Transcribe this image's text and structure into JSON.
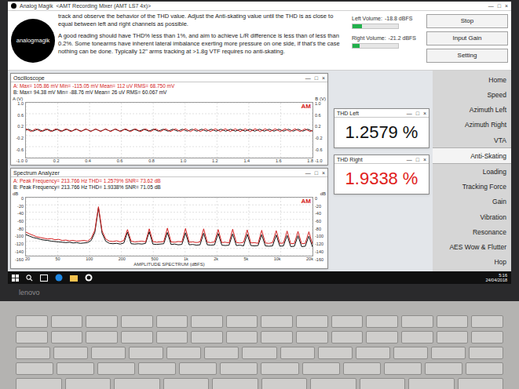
{
  "window": {
    "title": "Analog Magik",
    "subtitle": "<AMT Recording Mixer (AMT LS7 4x)>",
    "controls": [
      "—",
      "□",
      "×"
    ]
  },
  "logo": {
    "text": "analogmagik"
  },
  "instructions": [
    "track and observe the behavior of the THD value.  Adjust the Anti-skating value until the THD is as close to equal between left and right channels as possible.",
    "A good reading should have THD% less than 1%, and aim to achieve L/R difference is less than of less than 0.2%.   Some tonearms have inherent lateral imbalance exerting more pressure on one side, if that's the case nothing can be done.  Typically 12\" arms tracking at >1.8g VTF requires no anti-skating."
  ],
  "volumes": [
    {
      "label": "Left Volume:",
      "reading": "-18.8 dBFS",
      "level": 0.2,
      "color": "#22b14c"
    },
    {
      "label": "Right Volume:",
      "reading": "-21.2 dBFS",
      "level": 0.16,
      "color": "#22b14c"
    }
  ],
  "buttons": [
    "Stop",
    "Input Gain",
    "Setting"
  ],
  "oscilloscope": {
    "title": "Oscilloscope",
    "badge": "AM",
    "y_title_left": "A (V)",
    "y_title_right": "B (V)",
    "y_ticks": [
      "1.0",
      "0.6",
      "0.2",
      "-0.2",
      "-0.6",
      "-1.0"
    ],
    "right_ticks": [
      "1.0",
      "0.6",
      "0.2",
      "-0.2",
      "-0.6",
      "-1.0"
    ],
    "x_ticks": [
      "0",
      "0.2",
      "0.4",
      "0.6",
      "0.8",
      "1.0",
      "1.2",
      "1.4",
      "1.6",
      "1.8"
    ],
    "footer": "",
    "series": [
      {
        "name": "B",
        "color": "#111111",
        "readout": "B: Max=  94.38 mV   Min=  -88.76 mV   Mean=  26 uV   RMS=  60.067 mV",
        "values": [
          0,
          0.035,
          0,
          -0.035,
          0,
          0.035,
          0,
          -0.035,
          0,
          0.035,
          0,
          -0.035,
          0,
          0.035,
          0,
          -0.035,
          0,
          0.035,
          0,
          -0.035,
          0,
          0.035,
          0,
          -0.035,
          0,
          0.035,
          0,
          -0.035,
          0,
          0.035,
          0,
          -0.035,
          0,
          0.035,
          0,
          -0.035,
          0,
          0.035,
          0,
          -0.035,
          0,
          0.035,
          0,
          -0.035,
          0,
          0.035,
          0,
          -0.035,
          0,
          0.035,
          0,
          -0.035,
          0,
          0.035,
          0,
          -0.035,
          0,
          0.035,
          0,
          -0.035,
          0,
          0.035,
          0,
          -0.035,
          0,
          0.035,
          0,
          -0.035,
          0,
          0.035,
          0,
          -0.035,
          0,
          0.035,
          0,
          -0.035,
          0,
          0.035,
          0,
          -0.035,
          0,
          0.035,
          0,
          -0.035,
          0,
          0.035,
          0,
          -0.035,
          0,
          0.035,
          0,
          -0.035,
          0,
          0.035,
          0,
          -0.035,
          0,
          0.035,
          0,
          -0.035,
          0,
          0.035,
          0,
          -0.035,
          0,
          0.035,
          0,
          -0.035,
          0,
          0.035,
          0,
          -0.035,
          0,
          0.035,
          0,
          -0.035,
          0,
          0.035,
          0,
          -0.035
        ]
      },
      {
        "name": "A",
        "color": "#d42020",
        "readout": "A: Max=  105.86 mV   Min=  -115.05 mV   Mean=  112 uV   RMS=  68.750 mV",
        "values": [
          0.05,
          0,
          -0.05,
          0,
          0.05,
          0,
          -0.05,
          0,
          0.05,
          0,
          -0.05,
          0,
          0.05,
          0,
          -0.05,
          0,
          0.05,
          0,
          -0.05,
          0,
          0.05,
          0,
          -0.05,
          0,
          0.05,
          0,
          -0.05,
          0,
          0.05,
          0,
          -0.05,
          0,
          0.05,
          0,
          -0.05,
          0,
          0.05,
          0,
          -0.05,
          0,
          0.05,
          0,
          -0.05,
          0,
          0.05,
          0,
          -0.05,
          0,
          0.05,
          0,
          -0.05,
          0,
          0.05,
          0,
          -0.05,
          0,
          0.05,
          0,
          -0.05,
          0,
          0.05,
          0,
          -0.05,
          0,
          0.05,
          0,
          -0.05,
          0,
          0.05,
          0,
          -0.05,
          0,
          0.05,
          0,
          -0.05,
          0,
          0.05,
          0,
          -0.05,
          0,
          0.05,
          0,
          -0.05,
          0,
          0.05,
          0,
          -0.05,
          0,
          0.05,
          0,
          -0.05,
          0,
          0.05,
          0,
          -0.05,
          0,
          0.05,
          0,
          -0.05,
          0,
          0.05,
          0,
          -0.05,
          0,
          0.05,
          0,
          -0.05,
          0,
          0.05,
          0,
          -0.05,
          0,
          0.05,
          0,
          -0.05,
          0
        ]
      }
    ]
  },
  "spectrum": {
    "title": "Spectrum Analyzer",
    "badge": "AM",
    "y_title_left": "dB",
    "y_title_right": "dB",
    "y_ticks": [
      "0",
      "-20",
      "-40",
      "-60",
      "-80",
      "-100",
      "-120",
      "-140",
      "-160"
    ],
    "right_ticks": [
      "0",
      "-20",
      "-40",
      "-60",
      "-80",
      "-100",
      "-120",
      "-140",
      "-160"
    ],
    "x_ticks": [
      "20",
      "50",
      "100",
      "200",
      "500",
      "1k",
      "2k",
      "5k",
      "10k",
      "20k"
    ],
    "footer": "AMPLITUDE SPECTRUM (dBFS)",
    "series": [
      {
        "name": "B",
        "color": "#111111",
        "readout": "B: Peak Frequency=  213.766 Hz   THD=  1.9338%   SNR=  71.05 dB",
        "values": [
          -102,
          -106,
          -110,
          -112,
          -115,
          -117,
          -118,
          -120,
          -121,
          -122,
          -123,
          -124,
          -123,
          -125,
          -124,
          -126,
          -125,
          -124,
          -118,
          -96,
          -28,
          -98,
          -120,
          -126,
          -127,
          -126,
          -128,
          -125,
          -95,
          -127,
          -128,
          -127,
          -128,
          -126,
          -94,
          -128,
          -129,
          -128,
          -127,
          -96,
          -129,
          -128,
          -130,
          -129,
          -97,
          -130,
          -129,
          -131,
          -130,
          -98,
          -130,
          -131,
          -130,
          -99,
          -131,
          -132,
          -131,
          -100,
          -132,
          -131,
          -133,
          -101,
          -132,
          -133,
          -132,
          -102,
          -133,
          -134,
          -133,
          -103,
          -134,
          -133,
          -104,
          -135,
          -134,
          -105,
          -135,
          -134,
          -106,
          -136
        ]
      },
      {
        "name": "A",
        "color": "#d42020",
        "readout": "A: Peak Frequency=  213.766 Hz   THD=  1.2579%   SNR=  73.62 dB",
        "values": [
          -95,
          -100,
          -104,
          -108,
          -110,
          -112,
          -114,
          -113,
          -116,
          -115,
          -118,
          -117,
          -119,
          -118,
          -120,
          -119,
          -118,
          -120,
          -112,
          -90,
          -25,
          -92,
          -114,
          -120,
          -121,
          -119,
          -122,
          -118,
          -88,
          -120,
          -122,
          -121,
          -120,
          -122,
          -86,
          -121,
          -123,
          -122,
          -121,
          -84,
          -122,
          -123,
          -121,
          -122,
          -85,
          -123,
          -122,
          -124,
          -122,
          -86,
          -123,
          -124,
          -122,
          -88,
          -124,
          -123,
          -125,
          -87,
          -124,
          -125,
          -123,
          -89,
          -125,
          -124,
          -126,
          -90,
          -125,
          -126,
          -124,
          -91,
          -126,
          -125,
          -92,
          -127,
          -126,
          -93,
          -127,
          -126,
          -94,
          -128
        ]
      }
    ]
  },
  "thd": [
    {
      "label": "THD Left",
      "value": "1.2579",
      "unit": "%",
      "color": "#111111"
    },
    {
      "label": "THD Right",
      "value": "1.9338",
      "unit": "%",
      "color": "#e0201b"
    }
  ],
  "nav": [
    {
      "label": "Home",
      "selected": false
    },
    {
      "label": "Speed",
      "selected": false
    },
    {
      "label": "Azimuth Left",
      "selected": false
    },
    {
      "label": "Azimuth Right",
      "selected": false
    },
    {
      "label": "VTA",
      "selected": false
    },
    {
      "label": "Anti-Skating",
      "selected": true
    },
    {
      "label": "Loading",
      "selected": false
    },
    {
      "label": "Tracking Force",
      "selected": false
    },
    {
      "label": "Gain",
      "selected": false
    },
    {
      "label": "Vibration",
      "selected": false
    },
    {
      "label": "Resonance",
      "selected": false
    },
    {
      "label": "AES Wow & Flutter",
      "selected": false
    },
    {
      "label": "Hop",
      "selected": false
    }
  ],
  "taskbar": {
    "time": "5:16",
    "date": "24/04/2018"
  },
  "laptop": {
    "brand": "lenovo"
  }
}
